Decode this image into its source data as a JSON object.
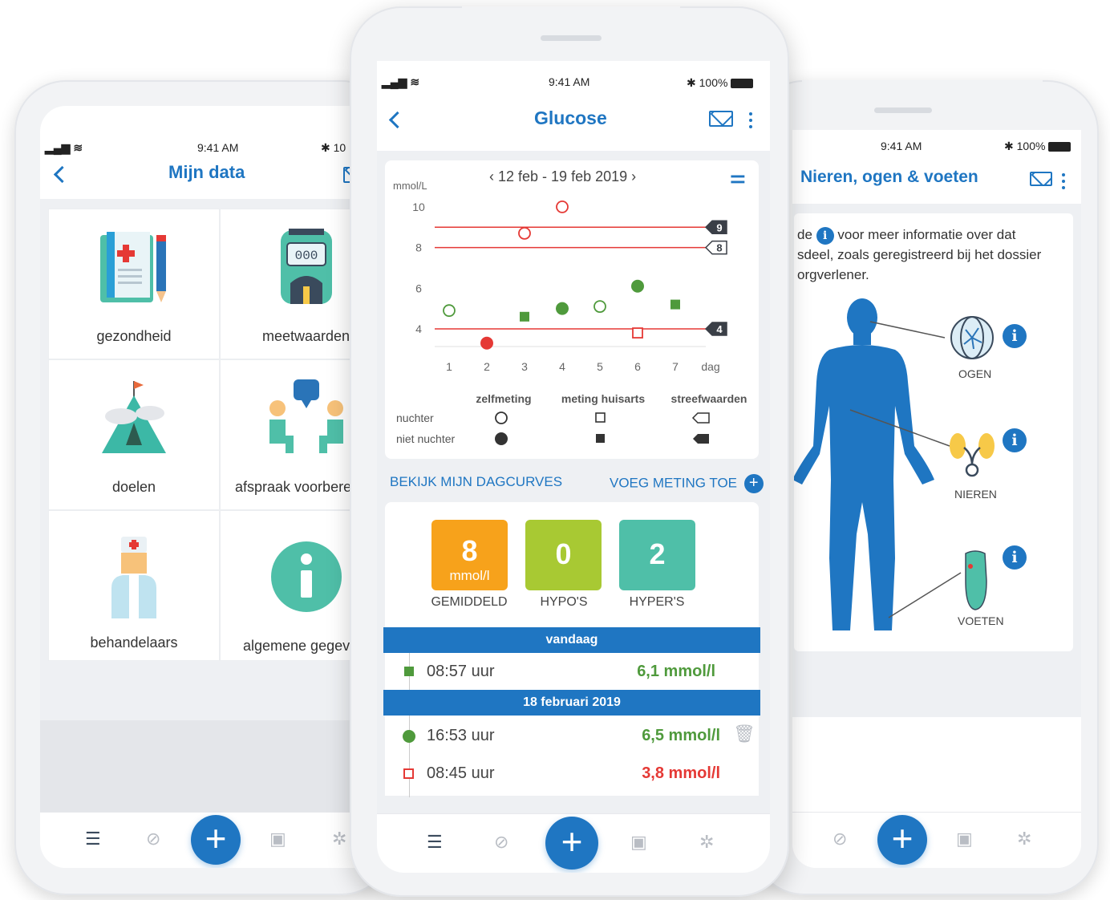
{
  "left": {
    "status": {
      "time": "9:41 AM",
      "battery": "10"
    },
    "title": "Mijn data",
    "tiles": [
      {
        "label": "gezondheid",
        "icon": "clipboard-icon"
      },
      {
        "label": "meetwaarden",
        "icon": "glucose-meter-icon"
      },
      {
        "label": "doelen",
        "icon": "mountain-flag-icon"
      },
      {
        "label": "afspraak voorbereiden",
        "icon": "conversation-icon"
      },
      {
        "label": "behandelaars",
        "icon": "nurse-icon"
      },
      {
        "label": "algemene gegevens",
        "icon": "info-icon"
      }
    ]
  },
  "center": {
    "status": {
      "time": "9:41 AM",
      "battery": "100%"
    },
    "title": "Glucose",
    "date_range": "12 feb - 19 feb 2019",
    "links": {
      "curves": "BEKIJK MIJN DAGCURVES",
      "add": "VOEG METING TOE"
    },
    "legend": {
      "col_self": "zelfmeting",
      "col_gp": "meting huisarts",
      "col_target": "streefwaarden",
      "row_fasting": "nuchter",
      "row_nonfasting": "niet nuchter"
    },
    "stats": [
      {
        "value": "8",
        "unit": "mmol/l",
        "label": "GEMIDDELD",
        "color": "#f7a21b"
      },
      {
        "value": "0",
        "unit": "",
        "label": "HYPO'S",
        "color": "#a8c933"
      },
      {
        "value": "2",
        "unit": "",
        "label": "HYPER'S",
        "color": "#4fbfa8"
      }
    ],
    "day_today": "vandaag",
    "day_prev": "18 februari 2019",
    "readings": [
      {
        "time": "08:57 uur",
        "value": "6,1 mmol/l",
        "color": "#4f9a3c"
      },
      {
        "time": "16:53 uur",
        "value": "6,5 mmol/l",
        "color": "#4f9a3c"
      },
      {
        "time": "08:45 uur",
        "value": "3,8 mmol/l",
        "color": "#e53935"
      }
    ]
  },
  "chart_data": {
    "type": "scatter",
    "ylabel": "mmol/L",
    "xlabel": "dag",
    "x_ticks": [
      "1",
      "2",
      "3",
      "4",
      "5",
      "6",
      "7"
    ],
    "y_ticks": [
      "4",
      "6",
      "8",
      "10"
    ],
    "ylim": [
      3,
      10.5
    ],
    "target_lines": [
      {
        "value": 9,
        "label": "9",
        "style": "filled"
      },
      {
        "value": 8,
        "label": "8",
        "style": "open"
      },
      {
        "value": 4,
        "label": "4",
        "style": "filled"
      }
    ],
    "series": [
      {
        "name": "zelfmeting nuchter",
        "points": [
          [
            1,
            4.9
          ],
          [
            3,
            8.7
          ],
          [
            4,
            10
          ],
          [
            5,
            5.1
          ]
        ]
      },
      {
        "name": "zelfmeting niet nuchter",
        "points": [
          [
            2,
            3.3
          ],
          [
            4,
            5
          ],
          [
            6,
            6.1
          ]
        ]
      },
      {
        "name": "meting huisarts nuchter",
        "points": [
          [
            6,
            3.8
          ]
        ]
      },
      {
        "name": "meting huisarts niet nuchter",
        "points": [
          [
            3,
            4.6
          ],
          [
            7,
            5.2
          ]
        ]
      }
    ]
  },
  "right": {
    "status": {
      "time": "9:41 AM",
      "battery": "100%"
    },
    "title": "Nieren, ogen & voeten",
    "intro_1": "de",
    "intro_2": "voor meer informatie over dat",
    "intro_3": "sdeel, zoals geregistreerd bij het dossier",
    "intro_4": "orgverlener.",
    "labels": {
      "eyes": "OGEN",
      "kidneys": "NIEREN",
      "feet": "VOETEN"
    }
  }
}
